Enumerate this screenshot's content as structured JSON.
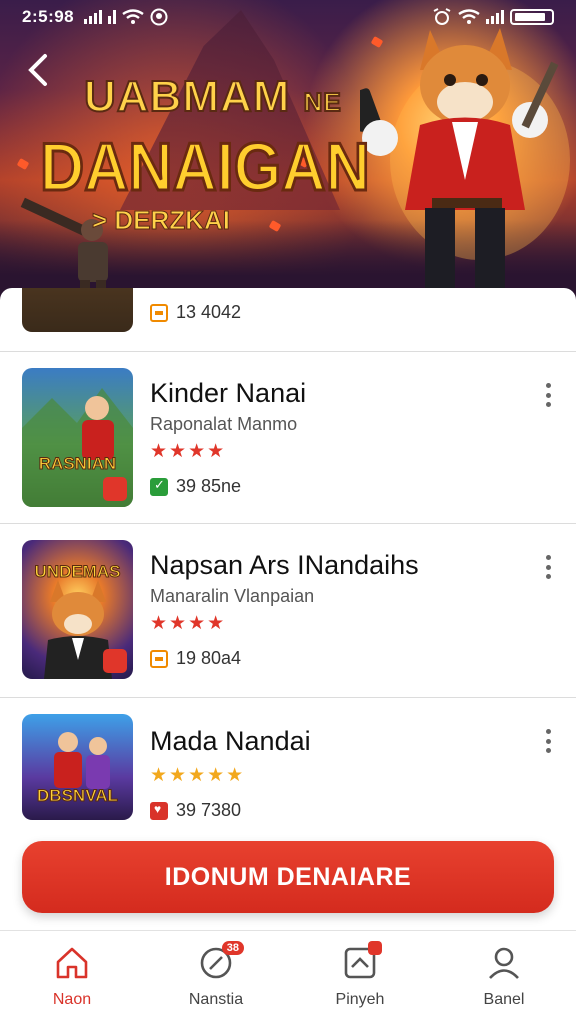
{
  "status_bar": {
    "time": "2:5:98"
  },
  "hero": {
    "line1": "UABMAM",
    "line1_suffix": "NE",
    "line2": "DANAIGAN",
    "line3": "> DERZKAI"
  },
  "list": {
    "top_partial": {
      "meta": "13 4042",
      "meta_icon": "calendar-icon"
    },
    "items": [
      {
        "title": "Kinder Nanai",
        "subtitle": "Raponalat Manmo",
        "stars": "★★★★",
        "rating_value": 4,
        "meta": "39 85ne",
        "meta_icon": "check-icon",
        "thumb_label": "RASNIAN",
        "star_color": "#e0362a"
      },
      {
        "title": "Napsan Ars INandaihs",
        "subtitle": "Manaralin Vlanpaian",
        "stars": "★★★★",
        "rating_value": 4,
        "meta": "19 80a4",
        "meta_icon": "calendar-icon",
        "thumb_label": "UNDEMAS",
        "star_color": "#e0362a"
      },
      {
        "title": "Mada Nandai",
        "subtitle": "",
        "stars": "★★★★★",
        "rating_value": 4.5,
        "meta": "39 7380",
        "meta_icon": "heart-icon",
        "thumb_label": "DBSNVAL",
        "star_color": "#f2a81d"
      }
    ]
  },
  "cta": {
    "label": "IDONUM DENAIARE"
  },
  "bottom_nav": {
    "items": [
      {
        "label": "Naon",
        "icon": "home-icon",
        "active": true
      },
      {
        "label": "Nanstia",
        "icon": "compass-icon",
        "badge": "38"
      },
      {
        "label": "Pinyeh",
        "icon": "library-icon"
      },
      {
        "label": "Banel",
        "icon": "profile-icon"
      }
    ]
  },
  "colors": {
    "accent": "#d9332a",
    "star_gold": "#f2a81d",
    "logo_yellow": "#ffce2e"
  }
}
